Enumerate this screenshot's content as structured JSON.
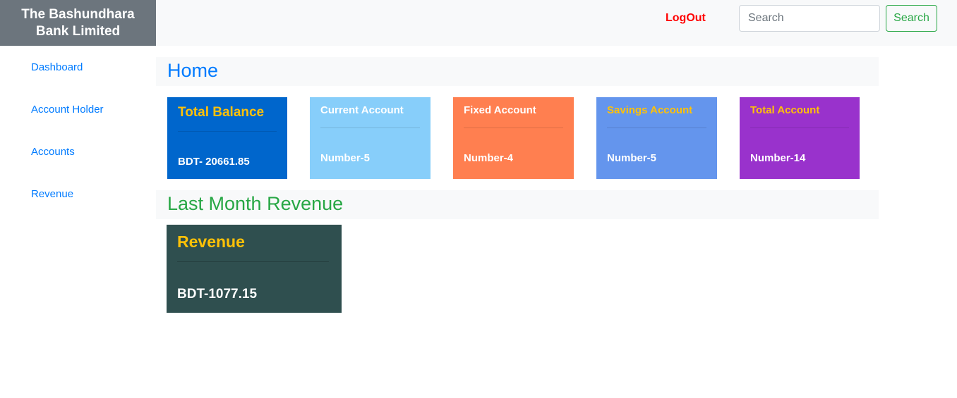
{
  "brand": {
    "line1": "The Bashundhara",
    "line2": "Bank Limited"
  },
  "navbar": {
    "logout_label": "LogOut",
    "search_placeholder": "Search",
    "search_button": "Search"
  },
  "sidebar": {
    "items": [
      {
        "label": "Dashboard"
      },
      {
        "label": "Account Holder"
      },
      {
        "label": "Accounts"
      },
      {
        "label": "Revenue"
      }
    ]
  },
  "home": {
    "title": "Home"
  },
  "cards": [
    {
      "title": "Total Balance",
      "value": "BDT- 20661.85",
      "bg": "#0066cc",
      "title_color": "#ffc107"
    },
    {
      "title": "Current Account",
      "value": "Number-5",
      "bg": "#87cefa",
      "title_color": "#ffffff"
    },
    {
      "title": "Fixed Account",
      "value": "Number-4",
      "bg": "#ff7f50",
      "title_color": "#ffffff"
    },
    {
      "title": "Savings Account",
      "value": "Number-5",
      "bg": "#6495ed",
      "title_color": "#ffc107"
    },
    {
      "title": "Total Account",
      "value": "Number-14",
      "bg": "#9932cc",
      "title_color": "#ffc107"
    }
  ],
  "revenue_section": {
    "title": "Last Month Revenue"
  },
  "revenue_card": {
    "title": "Revenue",
    "value": "BDT-1077.15",
    "bg": "#2f4f4f"
  },
  "colors": {
    "link": "#007bff",
    "home_title": "#007bff",
    "revenue_title": "#28a745",
    "logout": "#ff0000"
  }
}
